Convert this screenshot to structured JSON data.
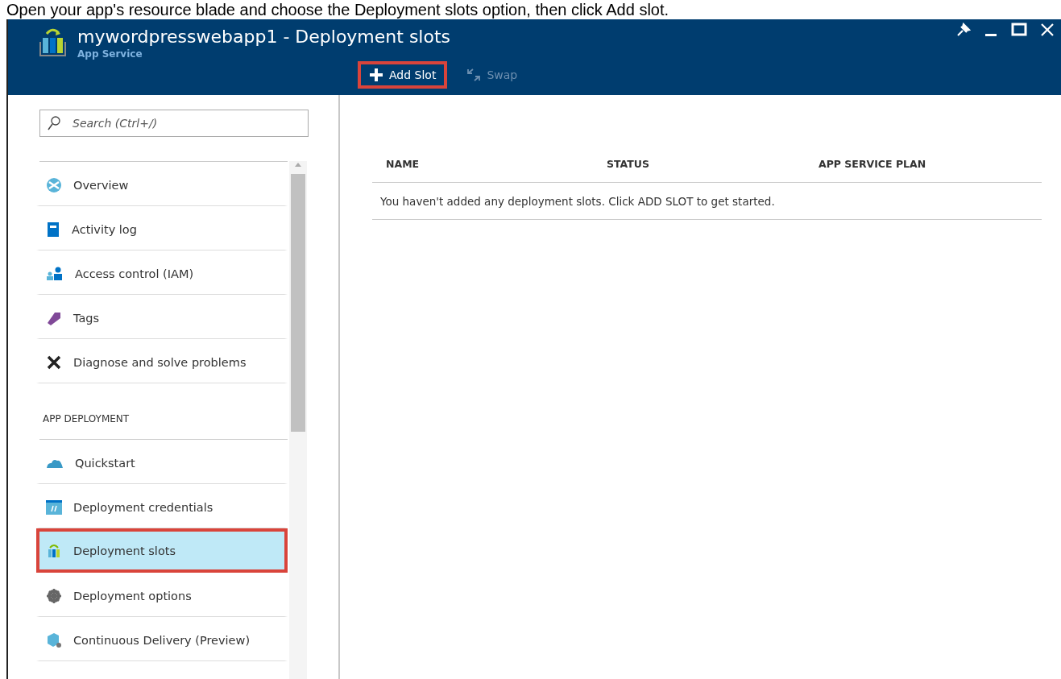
{
  "caption": "Open your app's resource blade and choose the Deployment slots option, then click Add slot.",
  "window": {
    "title": "mywordpresswebapp1 - Deployment slots",
    "subtitle": "App Service"
  },
  "toolbar": [
    {
      "label": "Add Slot",
      "disabled": false,
      "highlighted": true
    },
    {
      "label": "Swap",
      "disabled": true,
      "highlighted": false
    }
  ],
  "sidebar": {
    "search": {
      "placeholder": "Search (Ctrl+/)"
    },
    "groups": [
      {
        "items": [
          {
            "label": "Overview",
            "selected": false,
            "highlighted": false
          },
          {
            "label": "Activity log",
            "selected": false,
            "highlighted": false
          },
          {
            "label": "Access control (IAM)",
            "selected": false,
            "highlighted": false
          },
          {
            "label": "Tags",
            "selected": false,
            "highlighted": false
          },
          {
            "label": "Diagnose and solve problems",
            "selected": false,
            "highlighted": false
          }
        ]
      },
      {
        "heading": "APP DEPLOYMENT",
        "items": [
          {
            "label": "Quickstart",
            "selected": false,
            "highlighted": false
          },
          {
            "label": "Deployment credentials",
            "selected": false,
            "highlighted": false
          },
          {
            "label": "Deployment slots",
            "selected": true,
            "highlighted": true
          },
          {
            "label": "Deployment options",
            "selected": false,
            "highlighted": false
          },
          {
            "label": "Continuous Delivery (Preview)",
            "selected": false,
            "highlighted": false
          }
        ]
      }
    ]
  },
  "table": {
    "columns": [
      "NAME",
      "STATUS",
      "APP SERVICE PLAN"
    ],
    "empty_message": "You haven't added any deployment slots. Click ADD SLOT to get started."
  }
}
